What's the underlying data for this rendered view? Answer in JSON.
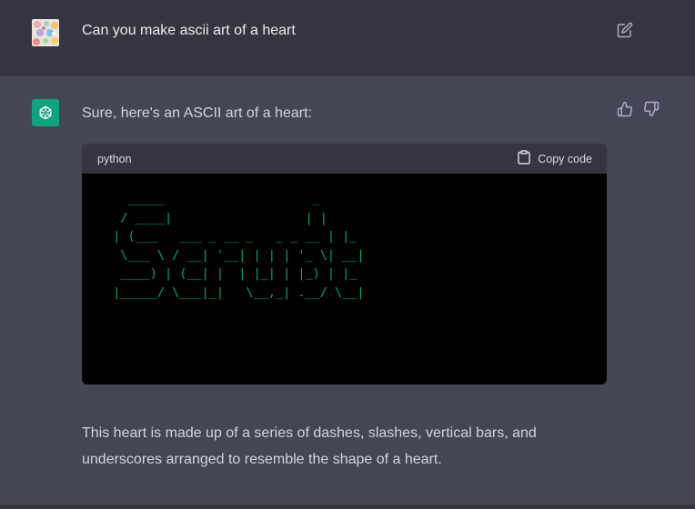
{
  "user_message": {
    "text": "Can you make ascii art of a heart",
    "avatar_icon": "user-avatar-icon",
    "edit_icon": "edit-icon"
  },
  "assistant_message": {
    "intro": "Sure, here's an ASCII art of a heart:",
    "avatar_icon": "openai-logo-icon",
    "avatar_color": "#10a37f",
    "feedback": {
      "thumbs_up_icon": "thumbs-up-icon",
      "thumbs_down_icon": "thumbs-down-icon"
    },
    "code_block": {
      "language": "python",
      "copy_label": "Copy code",
      "copy_icon": "clipboard-icon",
      "code_color": "#00a67d",
      "lines": [
        "   _____                    _",
        "  / ____|                  | |",
        " | (___   ___ _ __ _   _ _ __ | |_",
        "  \\___ \\ / __| '__| | | | '_ \\| __|",
        "  ____) | (__| |  | |_| | |_) | |_",
        " |_____/ \\___|_|   \\__,_| .__/ \\__|"
      ]
    },
    "explanation": "This heart is made up of a series of dashes, slashes, vertical bars, and underscores arranged to resemble the shape of a heart."
  }
}
